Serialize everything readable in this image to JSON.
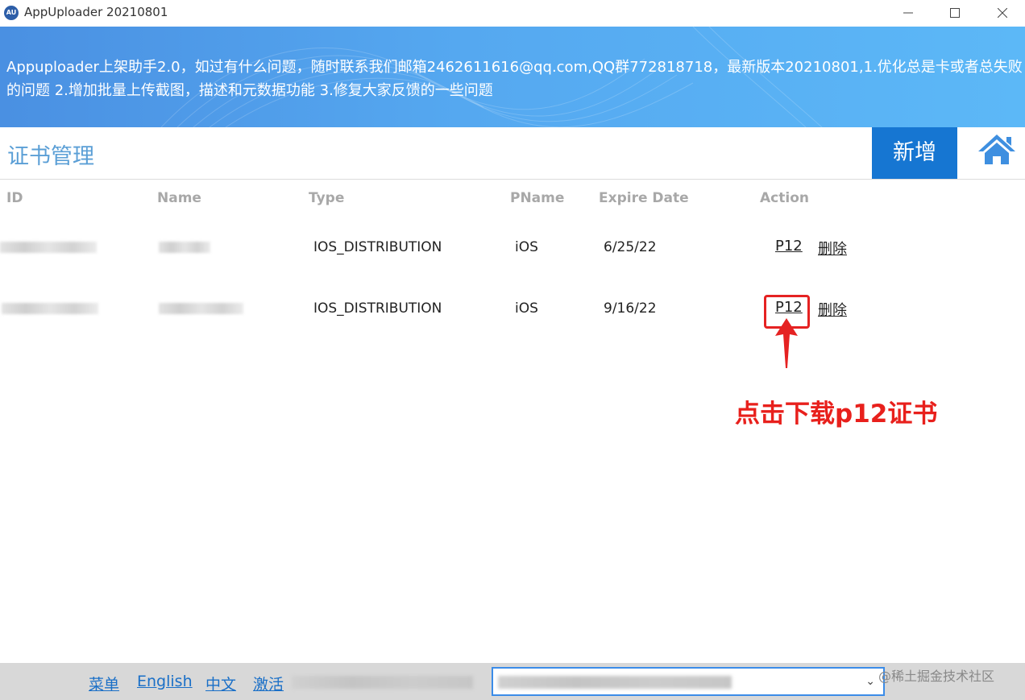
{
  "window": {
    "icon_text": "AU",
    "title": "AppUploader 20210801"
  },
  "banner": {
    "text": "Appuploader上架助手2.0，如过有什么问题，随时联系我们邮箱2462611616@qq.com,QQ群772818718，最新版本20210801,1.优化总是卡或者总失败的问题 2.增加批量上传截图，描述和元数据功能 3.修复大家反馈的一些问题"
  },
  "header": {
    "title": "证书管理",
    "add_label": "新增"
  },
  "table": {
    "columns": [
      "ID",
      "Name",
      "Type",
      "PName",
      "Expire Date",
      "Action"
    ],
    "rows": [
      {
        "type": "IOS_DISTRIBUTION",
        "pname": "iOS",
        "expire": "6/25/22",
        "p12": "P12",
        "delete": "删除"
      },
      {
        "type": "IOS_DISTRIBUTION",
        "pname": "iOS",
        "expire": "9/16/22",
        "p12": "P12",
        "delete": "删除"
      }
    ]
  },
  "annotation": {
    "text": "点击下载p12证书",
    "color": "#e8201c"
  },
  "footer": {
    "links": [
      "菜单",
      "English",
      "中文",
      "激活"
    ],
    "watermark": "@稀土掘金技术社区"
  },
  "colors": {
    "accent": "#1676d2",
    "title_blue": "#5b9fd6",
    "footer_link": "#1a6fc7"
  }
}
